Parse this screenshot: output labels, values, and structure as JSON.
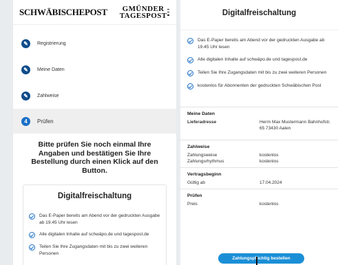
{
  "left": {
    "brand_left": "SchwäbischePost",
    "brand_right_line1": "GMÜNDER",
    "brand_right_line2": "TAGESPOST",
    "steps": [
      {
        "label": "Registrierung"
      },
      {
        "label": "Meine Daten"
      },
      {
        "label": "Zahlweise"
      },
      {
        "label": "Prüfen",
        "number": "4"
      }
    ],
    "intro": "Bitte prüfen Sie noch einmal Ihre Angaben und bestätigen Sie Ihre Bestellung durch einen Klick auf den Button.",
    "card_title": "Digitalfreischaltung",
    "features": [
      "Das E-Paper bereits am Abend vor der gedruckten Ausgabe ab 19.45 Uhr lesen",
      "Alle digitalen Inhalte auf schwäpo.de und tagespost.de",
      "Teilen Sie Ihre Zugangsdaten mit bis zu zwei weiteren Personen"
    ]
  },
  "right": {
    "title": "Digitalfreischaltung",
    "features": [
      "Das E-Paper bereits am Abend vor der gedruckten Ausgabe ab 19.45 Uhr lesen",
      "Alle digitalen Inhalte auf schwäpo.de und tagespost.de",
      "Teilen Sie Ihre Zugangsdaten mit bis zu zwei weiteren Personen",
      "kostenlos für Abonnenten der gedruckten Schwäbischen Post"
    ],
    "meine_daten": {
      "heading": "Meine Daten",
      "lieferadresse_label": "Lieferadresse",
      "lieferadresse_value": "Herrn Max Mustermann Bahnhofstr. 65 73430 Aalen"
    },
    "zahlweise": {
      "heading": "Zahlweise",
      "rows": [
        {
          "k": "Zahlungsweise",
          "v": "kostenlos"
        },
        {
          "k": "Zahlungsrhythmus",
          "v": "kostenlos"
        }
      ]
    },
    "vertragsbeginn": {
      "heading": "Vertragsbeginn",
      "k": "Gültig ab",
      "v": "17.04.2024"
    },
    "pruefen": {
      "heading": "Prüfen",
      "k": "Preis",
      "v": "kostenlos"
    },
    "order_button": "Zahlungspflichtig bestellen"
  },
  "colors": {
    "accent": "#1b6fc6",
    "button": "#1b8fd6",
    "step_active_bg": "#efefef"
  },
  "icons": {
    "step_done": "pencil-icon",
    "feature": "check-circle-icon",
    "menu": "hamburger-icon"
  }
}
